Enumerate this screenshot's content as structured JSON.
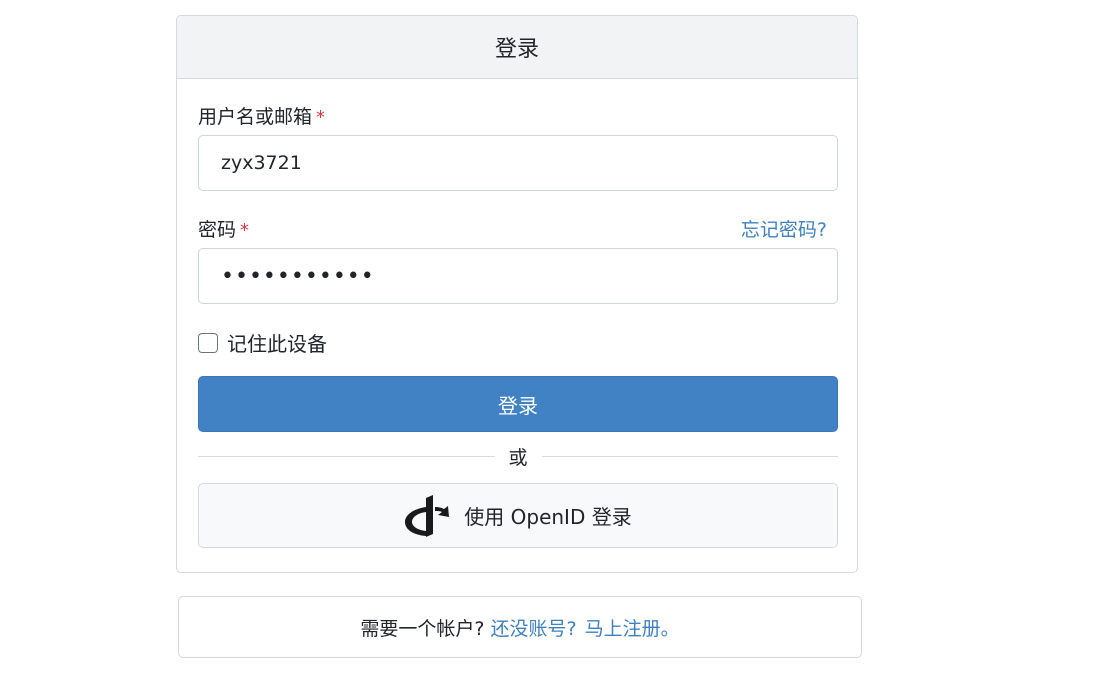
{
  "login_card": {
    "title": "登录",
    "username_label": "用户名或邮箱",
    "required_mark": "*",
    "username_value": "zyx3721",
    "password_label": "密码",
    "forgot_password": "忘记密码?",
    "password_value": "•••••••••••",
    "remember_label": "记住此设备",
    "remember_checked": false,
    "submit_label": "登录",
    "or_text": "或",
    "openid_label": "使用 OpenID 登录",
    "openid_icon": "openid-icon"
  },
  "register_card": {
    "prompt": "需要一个帐户?",
    "link1": "还没账号?",
    "link2": "马上注册。"
  },
  "colors": {
    "primary": "#4182c4",
    "link": "#3f80c1",
    "required": "#dc3545",
    "header_bg": "#f2f3f5"
  }
}
